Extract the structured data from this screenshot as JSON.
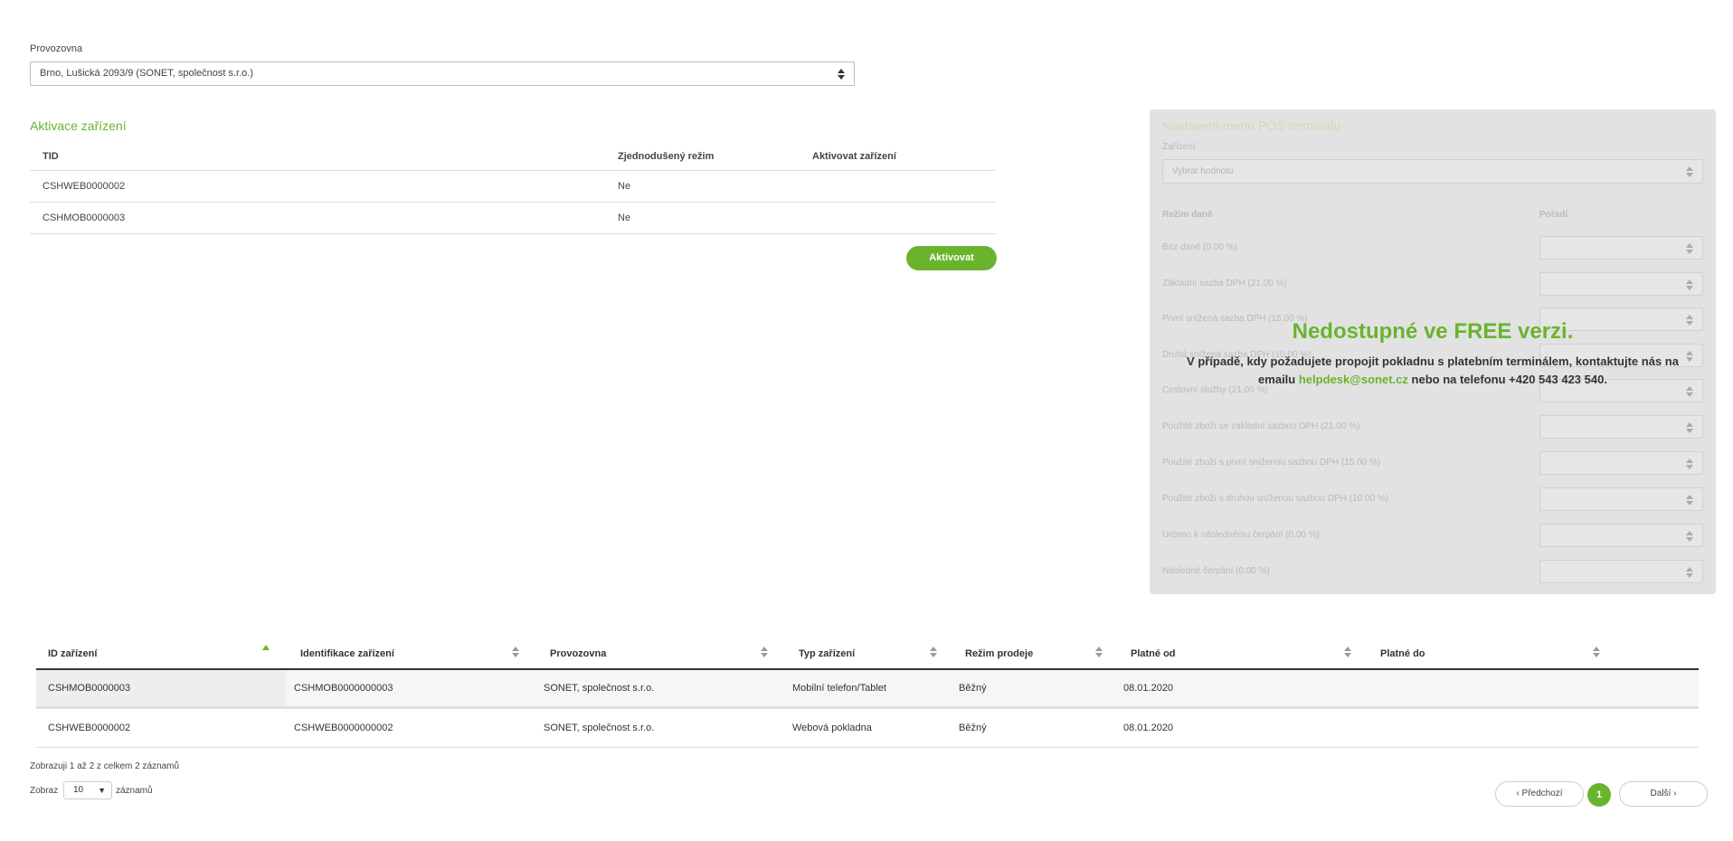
{
  "provozovna": {
    "label": "Provozovna",
    "value": "Brno, Lušická 2093/9 (SONET, společnost s.r.o.)"
  },
  "activation": {
    "title": "Aktivace zařízení",
    "columns": [
      "TID",
      "Zjednodušený režim",
      "Aktivovat zařízení"
    ],
    "rows": [
      {
        "tid": "CSHWEB0000002",
        "simplified": "Ne"
      },
      {
        "tid": "CSHMOB0000003",
        "simplified": "Ne"
      }
    ],
    "button_label": "Aktivovat"
  },
  "pos_menu": {
    "title": "Nastavení menu POS terminálu",
    "device_label": "Zařízení",
    "device_placeholder": "Vybrat hodnotu",
    "tax_header": "Režim daně",
    "order_header": "Pořadí",
    "tax_modes": [
      "Bez daně (0.00 %)",
      "Základní sazba DPH (21.00 %)",
      "První snížená sazba DPH (15.00 %)",
      "Druhá snížená sazba DPH (10.00 %)",
      "Cestovní služby (21.00 %)",
      "Použité zboží se základní sazbou DPH (21.00 %)",
      "Použité zboží s první sníženou sazbou DPH (15.00 %)",
      "Použité zboží s druhou sníženou sazbou DPH (10.00 %)",
      "Určeno k následnému čerpání (0.00 %)",
      "Následné čerpání (0.00 %)"
    ],
    "overlay": {
      "title": "Nedostupné ve FREE verzi.",
      "text_before": "V případě, kdy požadujete propojit pokladnu s platebním terminálem, kontaktujte nás na emailu",
      "email": "helpdesk@sonet.cz",
      "text_after": "nebo na telefonu +420 543 423 540."
    }
  },
  "devices": {
    "columns": [
      "ID zařízení",
      "Identifikace zařízení",
      "Provozovna",
      "Typ zařízení",
      "Režim prodeje",
      "Platné od",
      "Platné do"
    ],
    "rows": [
      [
        "CSHMOB0000003",
        "CSHMOB0000000003",
        "SONET, společnost s.r.o.",
        "Mobilní telefon/Tablet",
        "Běžný",
        "08.01.2020",
        ""
      ],
      [
        "CSHWEB0000002",
        "CSHWEB0000000002",
        "SONET, společnost s.r.o.",
        "Webová pokladna",
        "Běžný",
        "08.01.2020",
        ""
      ]
    ],
    "info": "Zobrazuji 1 až 2 z celkem 2 záznamů",
    "show_label": "Zobraz",
    "page_length": "10",
    "records_label": "záznamů"
  },
  "pagination": {
    "prev": "‹ Předchozí",
    "current": "1",
    "next": "Další ›"
  },
  "colors": {
    "accent": "#6ab42d",
    "panel_bg": "#e2e2e2"
  }
}
